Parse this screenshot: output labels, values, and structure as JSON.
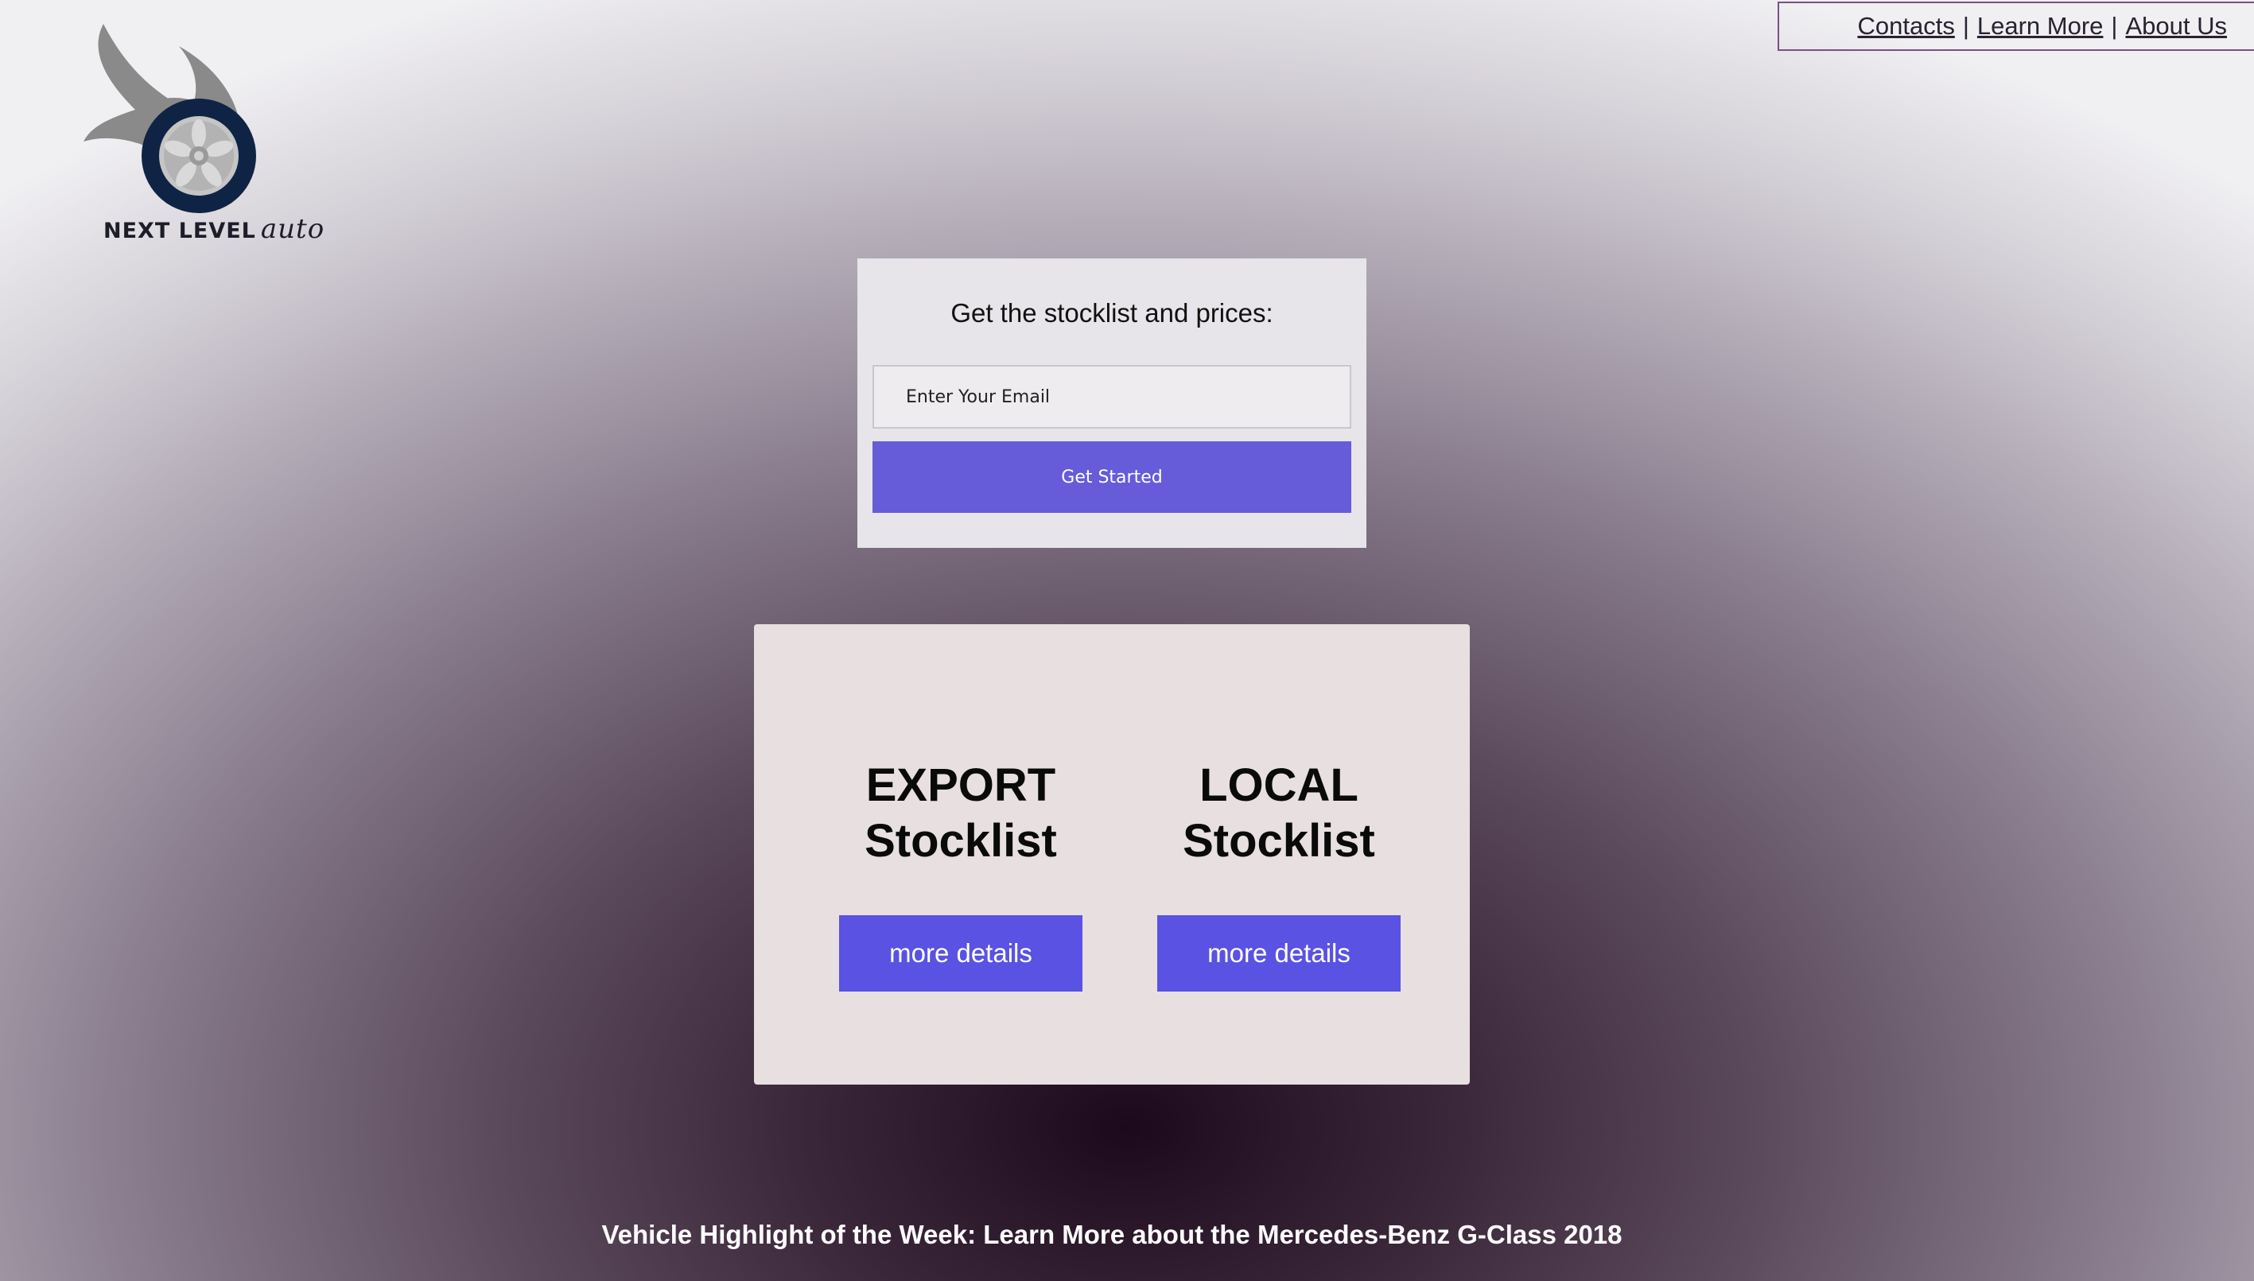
{
  "nav": {
    "links": [
      "Contacts",
      "Learn More",
      "About Us"
    ],
    "separator": "|",
    "border_color": "#7a4f86"
  },
  "logo": {
    "icon": "flaming-wheel-logo",
    "text_main": "NEXT LEVEL",
    "text_script": "auto"
  },
  "signup": {
    "title": "Get the stocklist and prices:",
    "email_placeholder": "Enter Your Email",
    "button_label": "Get Started",
    "button_color": "#665cd9"
  },
  "stocklists": [
    {
      "line1": "EXPORT",
      "line2": "Stocklist",
      "button_label": "more details"
    },
    {
      "line1": "LOCAL",
      "line2": "Stocklist",
      "button_label": "more details"
    }
  ],
  "footer": {
    "highlight": "Vehicle Highlight of the Week: Learn More about the Mercedes-Benz G-Class 2018"
  },
  "colors": {
    "button": "#5a52e2",
    "card_bg": "#e8dfe0",
    "background_center": "#1c0a1c",
    "background_edge": "#f0eff2"
  }
}
